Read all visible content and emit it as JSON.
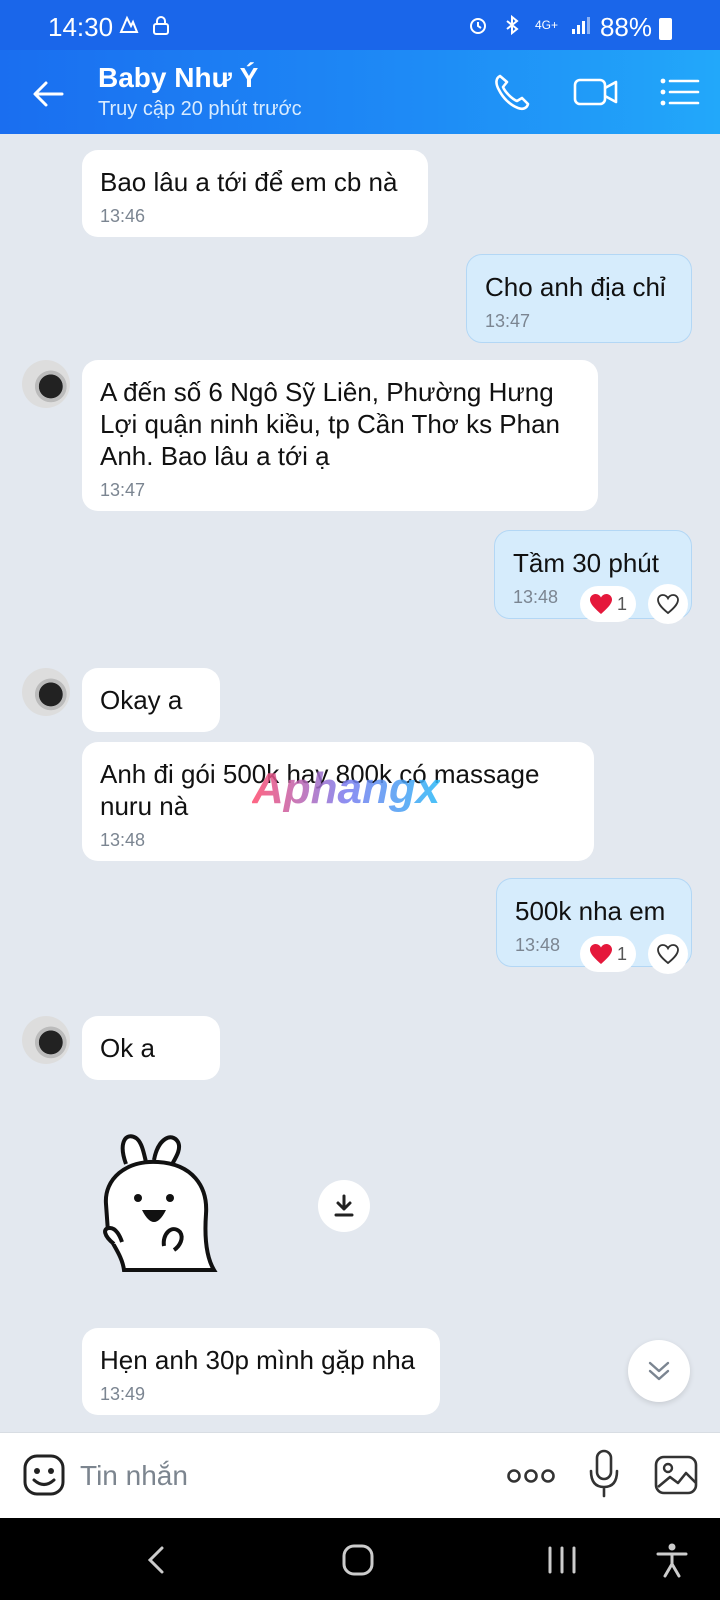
{
  "status_bar": {
    "time": "14:30",
    "battery": "88%",
    "network": "4G+"
  },
  "header": {
    "contact_name": "Baby Như Ý",
    "last_seen": "Truy cập 20 phút trước"
  },
  "messages": [
    {
      "direction": "in",
      "text": "Bao lâu a tới để em cb nà",
      "time": "13:46"
    },
    {
      "direction": "out",
      "text": "Cho anh địa chỉ",
      "time": "13:47"
    },
    {
      "direction": "in",
      "text": "A đến số 6 Ngô Sỹ Liên, Phường Hưng Lợi quận ninh kiều, tp Cần Thơ ks Phan Anh. Bao lâu a tới ạ",
      "time": "13:47"
    },
    {
      "direction": "out",
      "text": "Tầm 30 phút",
      "time": "13:48",
      "reaction_count": "1"
    },
    {
      "direction": "in",
      "text": "Okay a"
    },
    {
      "direction": "in",
      "text": "Anh đi gói 500k hay 800k có massage nuru nà",
      "time": "13:48"
    },
    {
      "direction": "out",
      "text": "500k nha em",
      "time": "13:48",
      "reaction_count": "1"
    },
    {
      "direction": "in",
      "text": "Ok a"
    },
    {
      "direction": "in",
      "text": "Hẹn anh 30p mình gặp nha",
      "time": "13:49"
    }
  ],
  "watermark": "Aphangx",
  "composer": {
    "placeholder": "Tin nhắn"
  },
  "icons": {
    "back": "arrow-left-icon",
    "call": "phone-icon",
    "video": "video-camera-icon",
    "menu": "list-menu-icon",
    "emoji": "emoji-icon",
    "more": "more-dots-icon",
    "mic": "microphone-icon",
    "gallery": "image-icon",
    "download": "download-icon",
    "scroll": "chevron-double-down-icon"
  },
  "colors": {
    "header": "#1e8cf6",
    "chat_bg": "#e3e8ef",
    "out_bubble": "#d6ecfc",
    "in_bubble": "#ffffff",
    "reaction_heart": "#e5183b"
  }
}
